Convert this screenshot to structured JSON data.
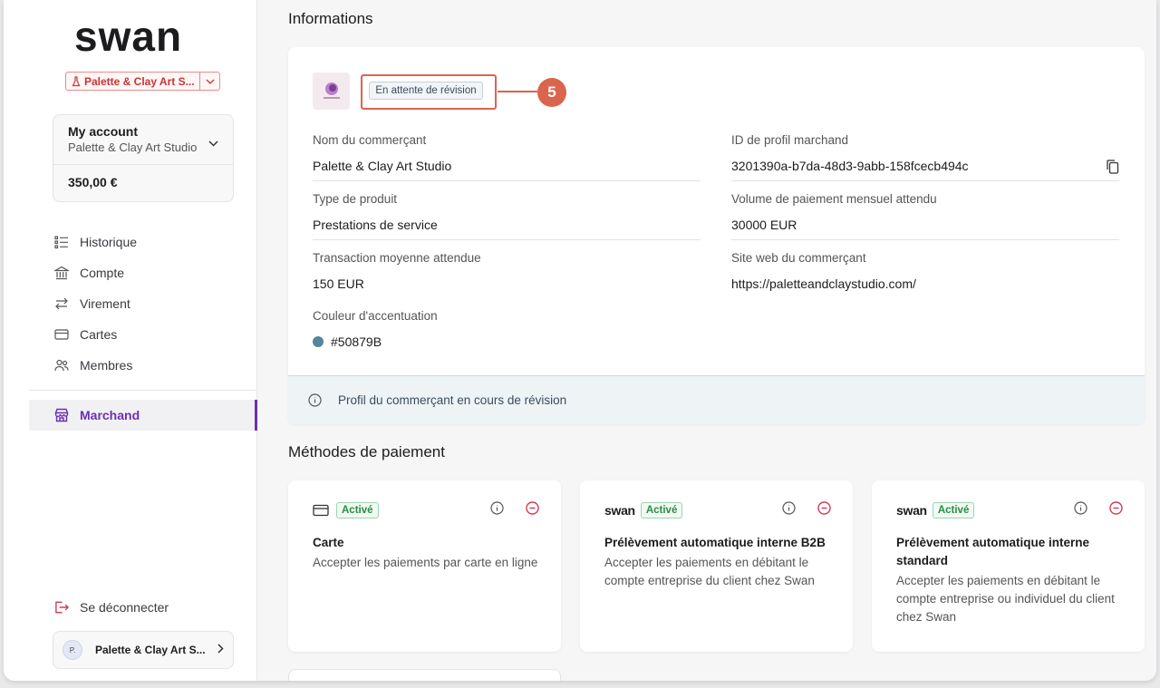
{
  "sidebar": {
    "brand": "swan",
    "project_name": "Palette & Clay Art S...",
    "account": {
      "title": "My account",
      "holder": "Palette & Clay Art Studio",
      "balance": "350,00 €"
    },
    "nav": [
      {
        "label": "Historique",
        "icon": "history-list-icon"
      },
      {
        "label": "Compte",
        "icon": "bank-icon"
      },
      {
        "label": "Virement",
        "icon": "transfer-arrows-icon"
      },
      {
        "label": "Cartes",
        "icon": "card-icon"
      },
      {
        "label": "Membres",
        "icon": "members-icon"
      }
    ],
    "active_item": {
      "label": "Marchand",
      "icon": "storefront-icon"
    },
    "logout_label": "Se déconnecter",
    "user": {
      "initials": "P.",
      "name": "Palette & Clay Art S..."
    }
  },
  "main": {
    "info_title": "Informations",
    "status_badge": "En attente de révision",
    "callout_number": "5",
    "fields": {
      "merchant_name": {
        "label": "Nom du commerçant",
        "value": "Palette & Clay Art Studio"
      },
      "profile_id": {
        "label": "ID de profil marchand",
        "value": "3201390a-b7da-48d3-9abb-158fcecb494c"
      },
      "product_type": {
        "label": "Type de produit",
        "value": "Prestations de service"
      },
      "monthly_volume": {
        "label": "Volume de paiement mensuel attendu",
        "value": "30000 EUR"
      },
      "avg_transaction": {
        "label": "Transaction moyenne attendue",
        "value": "150 EUR"
      },
      "website": {
        "label": "Site web du commerçant",
        "value": "https://paletteandclaystudio.com/"
      },
      "accent_color": {
        "label": "Couleur d'accentuation",
        "value": "#50879B"
      }
    },
    "notice": "Profil du commerçant en cours de révision",
    "payment_title": "Méthodes de paiement",
    "payment_methods": [
      {
        "brand": "",
        "icon": "card-icon",
        "status": "Activé",
        "title": "Carte",
        "description": "Accepter les paiements par carte en ligne"
      },
      {
        "brand": "swan",
        "icon": "",
        "status": "Activé",
        "title": "Prélèvement automatique interne B2B",
        "description": "Accepter les paiements en débitant le compte entreprise du client chez Swan"
      },
      {
        "brand": "swan",
        "icon": "",
        "status": "Activé",
        "title": "Prélèvement automatique interne standard",
        "description": "Accepter les paiements en débitant le compte entreprise ou individuel du client chez Swan"
      }
    ]
  },
  "colors": {
    "accent_purple": "#6b2fb3",
    "callout": "#d9654d",
    "merchant_accent": "#50879B",
    "danger": "#d23b55",
    "active_green": "#2c8a45"
  }
}
